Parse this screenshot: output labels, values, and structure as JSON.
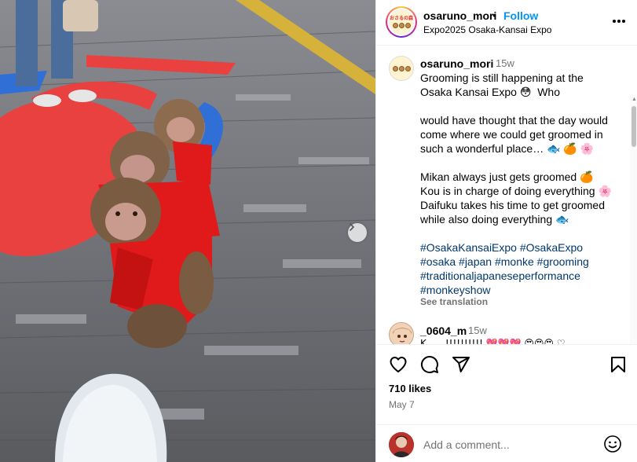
{
  "post": {
    "username": "osaruno_mori",
    "follow_label": "Follow",
    "location": "Expo2025 Osaka-Kansai Expo",
    "avatar_text": "おさるの森"
  },
  "caption": {
    "username": "osaruno_mori",
    "time": "15w",
    "text": "Grooming is still happening at the Osaka Kansai Expo 😳  Who\n\nwould have thought that the day would come where we could get groomed in such a wonderful place… 🐟 🍊 🌸\n\nMikan always just gets groomed 🍊\nKou is in charge of doing everything 🌸\nDaifuku takes his time to get groomed while also doing everything 🐟\n\n",
    "hashtags": "#OsakaKansaiExpo #OsakaExpo #osaka #japan #monke #grooming #traditionaljapaneseperformance #monkeyshow",
    "see_translation": "See translation"
  },
  "comment2": {
    "username": "_0604_m",
    "time": "15w",
    "text": "K……!!!!!!!!!! 💖💖💖 😍😍😍 ♡"
  },
  "likes": "710 likes",
  "date": "May 7",
  "add_comment": {
    "placeholder": "Add a comment..."
  },
  "icons": {
    "like": "heart-icon",
    "comment": "comment-icon",
    "share": "share-icon",
    "save": "bookmark-icon",
    "more": "more-icon",
    "next": "chevron-right-icon",
    "emoji": "emoji-icon"
  },
  "colors": {
    "link": "#0095f6",
    "hashtag": "#00376b",
    "muted": "#737373",
    "kimono": "#e01a1a"
  }
}
